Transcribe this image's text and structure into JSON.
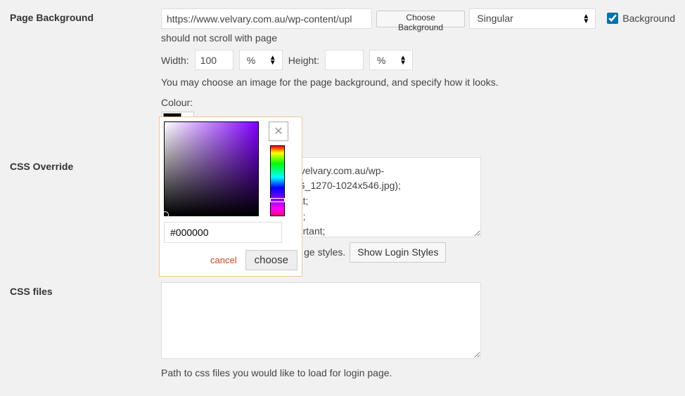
{
  "pageBg": {
    "label": "Page Background",
    "url": "https://www.velvary.com.au/wp-content/upl",
    "chooseBtn": "Choose Background",
    "repeatOption": "Singular",
    "fixedCheckboxLabel": "Background",
    "fixedHint": "should not scroll with page",
    "widthLabel": "Width:",
    "widthValue": "100",
    "widthUnit": "%",
    "heightLabel": "Height:",
    "heightValue": "",
    "heightUnit": "%",
    "helpText": "You may choose an image for the page background, and specify how it looks.",
    "colourLabel": "Colour:",
    "colourValue": "#000000"
  },
  "cssOverride": {
    "label": "CSS Override",
    "textarea": "                                               .velvary.com.au/wp-\n                                               G_1270-1024x546.jpg);\n                                               at;\n                                               d;\n                                               ortant;",
    "hint": "ge styles.",
    "showBtn": "Show Login Styles"
  },
  "cssFiles": {
    "label": "CSS files",
    "helpText": "Path to css files you would like to load for login page."
  },
  "picker": {
    "hex": "#000000",
    "cancel": "cancel",
    "choose": "choose"
  }
}
